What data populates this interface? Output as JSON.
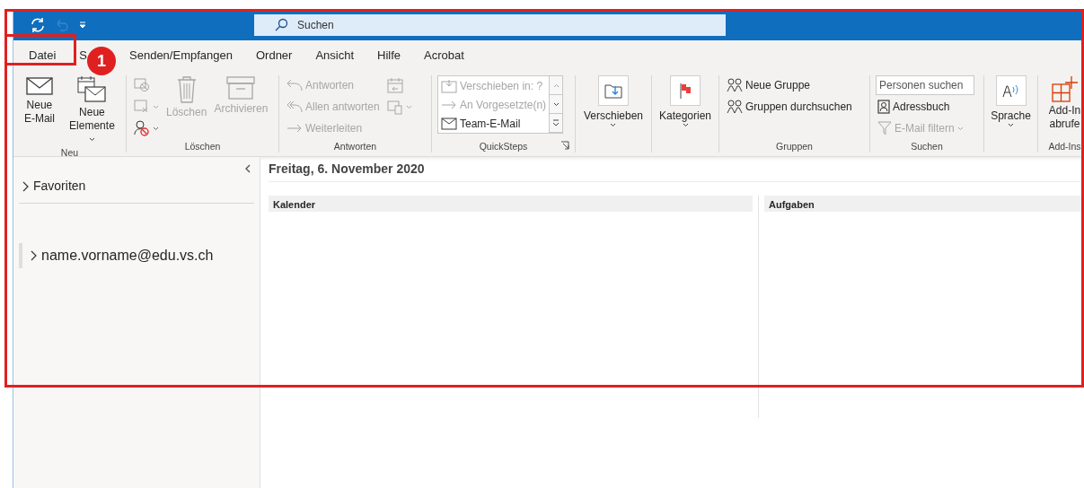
{
  "title_bar": {
    "search": {
      "placeholder": "Suchen"
    },
    "undo_disabled": true
  },
  "tabs": [
    {
      "label": "Datei"
    },
    {
      "label": "S"
    },
    {
      "label": "Senden/Empfangen"
    },
    {
      "label": "Ordner"
    },
    {
      "label": "Ansicht"
    },
    {
      "label": "Hilfe"
    },
    {
      "label": "Acrobat"
    }
  ],
  "ribbon_groups": [
    {
      "label": "Neu",
      "items": [
        {
          "kind": "large",
          "label": "Neue E-Mail",
          "disabled": false,
          "dropdown": false
        },
        {
          "kind": "large",
          "label": "Neue Elemente",
          "disabled": false,
          "dropdown": true
        }
      ]
    },
    {
      "label": "Löschen",
      "items": [
        {
          "kind": "stack",
          "items": [
            {
              "kind": "icon",
              "disabled": true,
              "dropdown": false
            },
            {
              "kind": "icon",
              "disabled": true,
              "dropdown": true
            },
            {
              "kind": "icon",
              "disabled": false,
              "dropdown": true
            }
          ]
        },
        {
          "kind": "large",
          "label": "Löschen",
          "disabled": true,
          "dropdown": false
        },
        {
          "kind": "large",
          "label": "Archivieren",
          "disabled": true,
          "dropdown": false
        }
      ]
    },
    {
      "label": "Antworten",
      "items": [
        {
          "kind": "stack",
          "items": [
            {
              "kind": "small",
              "label": "Antworten",
              "disabled": true,
              "dropdown": false
            },
            {
              "kind": "small",
              "label": "Allen antworten",
              "disabled": true,
              "dropdown": false
            },
            {
              "kind": "small",
              "label": "Weiterleiten",
              "disabled": true,
              "dropdown": false
            }
          ]
        },
        {
          "kind": "stack",
          "items": [
            {
              "kind": "icon",
              "disabled": true,
              "dropdown": false
            },
            {
              "kind": "icon",
              "disabled": true,
              "dropdown": true
            }
          ]
        }
      ]
    },
    {
      "label": "QuickSteps",
      "launcher": true,
      "items": [
        {
          "kind": "gallery",
          "entries": [
            {
              "label": "Verschieben in: ?",
              "disabled": true
            },
            {
              "label": "An Vorgesetzte(n)",
              "disabled": true
            },
            {
              "label": "Team-E-Mail",
              "disabled": false
            }
          ]
        }
      ]
    },
    {
      "items": [
        {
          "kind": "boxed",
          "label": "Verschieben",
          "disabled": false,
          "dropdown": true
        }
      ]
    },
    {
      "items": [
        {
          "kind": "boxed",
          "label": "Kategorien",
          "disabled": false,
          "dropdown": true
        }
      ]
    },
    {
      "label": "Gruppen",
      "items": [
        {
          "kind": "stack",
          "items": [
            {
              "kind": "small",
              "label": "Neue Gruppe",
              "disabled": false,
              "dropdown": false
            },
            {
              "kind": "small",
              "label": "Gruppen durchsuchen",
              "disabled": false,
              "dropdown": false
            }
          ]
        }
      ]
    },
    {
      "label": "Suchen",
      "items": [
        {
          "kind": "stack",
          "items": [
            {
              "kind": "field",
              "placeholder": "Personen suchen"
            },
            {
              "kind": "small",
              "label": "Adressbuch",
              "disabled": false,
              "dropdown": false
            },
            {
              "kind": "small",
              "label": "E-Mail filtern",
              "disabled": true,
              "dropdown": true
            }
          ]
        }
      ]
    },
    {
      "items": [
        {
          "kind": "boxed",
          "label": "Sprache",
          "disabled": false,
          "dropdown": true
        }
      ]
    },
    {
      "label": "Add-Ins",
      "items": [
        {
          "kind": "large",
          "label": "Add-In abrufe",
          "disabled": false,
          "dropdown": false
        }
      ]
    }
  ],
  "folder_pane": {
    "sections": [
      {
        "label": "Favoriten",
        "expanded": false
      },
      {
        "label": "name.vorname@edu.vs.ch",
        "expanded": false
      }
    ]
  },
  "today": {
    "date": "Freitag, 6. November 2020",
    "panels": [
      {
        "title": "Kalender"
      },
      {
        "title": "Aufgaben"
      }
    ]
  },
  "annotations": [
    {
      "kind": "highlight"
    },
    {
      "kind": "frame"
    },
    {
      "kind": "badge",
      "label": "1"
    }
  ]
}
